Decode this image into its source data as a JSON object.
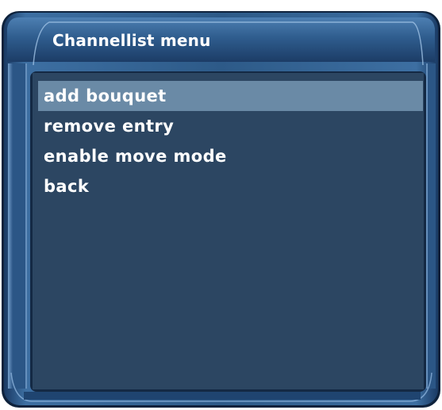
{
  "window": {
    "title": "Channellist menu"
  },
  "menu": {
    "items": [
      {
        "label": "add bouquet",
        "selected": true
      },
      {
        "label": "remove entry",
        "selected": false
      },
      {
        "label": "enable move mode",
        "selected": false
      },
      {
        "label": "back",
        "selected": false
      }
    ]
  },
  "colors": {
    "frame": "#2f5d8c",
    "frame_dark": "#142944",
    "panel": "#2c4662",
    "selection": "#6a8aa6",
    "text": "#ffffff"
  }
}
